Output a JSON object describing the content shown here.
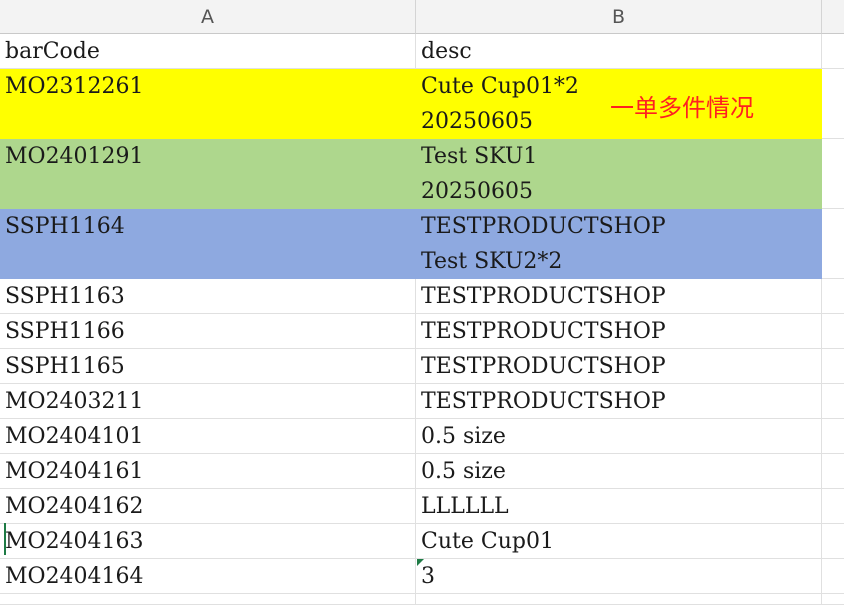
{
  "columns": [
    "A",
    "B"
  ],
  "header_row": {
    "barCode": "barCode",
    "desc": "desc"
  },
  "rows": [
    {
      "barCode": "MO2312261",
      "desc": [
        "Cute Cup01*2",
        "20250605"
      ],
      "fill": "#ffff00"
    },
    {
      "barCode": "MO2401291",
      "desc": [
        "Test SKU1",
        "20250605"
      ],
      "fill": "#aed78d"
    },
    {
      "barCode": "SSPH1164",
      "desc": [
        "TESTPRODUCTSHOP",
        "Test SKU2*2"
      ],
      "fill": "#8ea9e0"
    },
    {
      "barCode": "SSPH1163",
      "desc": [
        "TESTPRODUCTSHOP"
      ]
    },
    {
      "barCode": "SSPH1166",
      "desc": [
        "TESTPRODUCTSHOP"
      ]
    },
    {
      "barCode": "SSPH1165",
      "desc": [
        "TESTPRODUCTSHOP"
      ]
    },
    {
      "barCode": "MO2403211",
      "desc": [
        "TESTPRODUCTSHOP"
      ]
    },
    {
      "barCode": "MO2404101",
      "desc": [
        "0.5 size"
      ]
    },
    {
      "barCode": "MO2404161",
      "desc": [
        "0.5 size"
      ]
    },
    {
      "barCode": "MO2404162",
      "desc": [
        "LLLLLL"
      ]
    },
    {
      "barCode": "MO2404163",
      "desc": [
        "Cute Cup01"
      ]
    },
    {
      "barCode": "MO2404164",
      "desc": [
        "3"
      ]
    }
  ],
  "note_text": "一单多件情况",
  "colors": {
    "note": "#ff2020",
    "header_bg": "#f3f3f3",
    "gridline": "#e0e0e0"
  }
}
